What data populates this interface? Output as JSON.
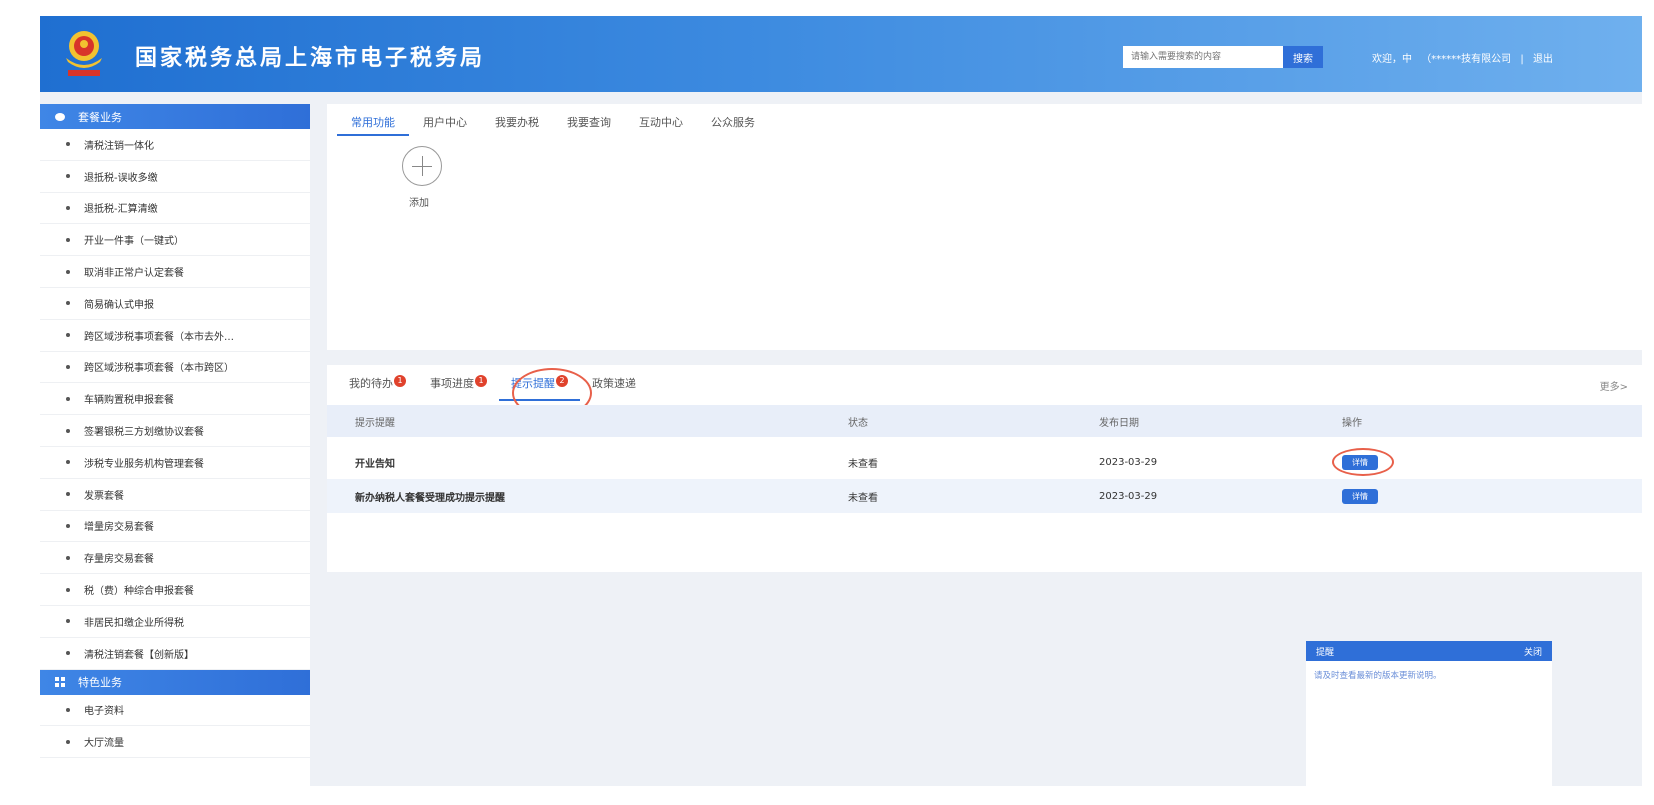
{
  "header": {
    "site_title": "国家税务总局上海市电子税务局",
    "search_placeholder": "请输入需要搜索的内容",
    "search_button": "搜索",
    "welcome": "欢迎，中",
    "company": "（******技有限公司",
    "separator": "|",
    "logout": "退出"
  },
  "sidebar": {
    "section1": "套餐业务",
    "items": [
      "清税注销一体化",
      "退抵税-误收多缴",
      "退抵税-汇算清缴",
      "开业一件事（一键式）",
      "取消非正常户认定套餐",
      "简易确认式申报",
      "跨区域涉税事项套餐（本市去外…",
      "跨区域涉税事项套餐（本市跨区）",
      "车辆购置税申报套餐",
      "签署银税三方划缴协议套餐",
      "涉税专业服务机构管理套餐",
      "发票套餐",
      "增量房交易套餐",
      "存量房交易套餐",
      "税（费）种综合申报套餐",
      "非居民扣缴企业所得税",
      "清税注销套餐【创新版】"
    ],
    "section2": "特色业务",
    "items2": [
      "电子资料",
      "大厅流量"
    ]
  },
  "top_tabs": [
    "常用功能",
    "用户中心",
    "我要办税",
    "我要查询",
    "互动中心",
    "公众服务"
  ],
  "add_label": "添加",
  "lower_tabs": [
    {
      "label": "我的待办",
      "badge": "1"
    },
    {
      "label": "事项进度",
      "badge": "1"
    },
    {
      "label": "提示提醒",
      "badge": "2"
    },
    {
      "label": "政策速递",
      "badge": ""
    }
  ],
  "more": "更多>",
  "table": {
    "headers": [
      "提示提醒",
      "状态",
      "发布日期",
      "操作"
    ],
    "rows": [
      {
        "title": "开业告知",
        "status": "未查看",
        "date": "2023-03-29",
        "action": "详情"
      },
      {
        "title": "新办纳税人套餐受理成功提示提醒",
        "status": "未查看",
        "date": "2023-03-29",
        "action": "详情"
      }
    ]
  },
  "notice": {
    "title": "提醒",
    "close": "关闭",
    "body": "请及时查看最新的版本更新说明。"
  },
  "colors": {
    "primary": "#2f6fd8",
    "highlight_ring": "#e8604a",
    "badge": "#e0422c"
  }
}
